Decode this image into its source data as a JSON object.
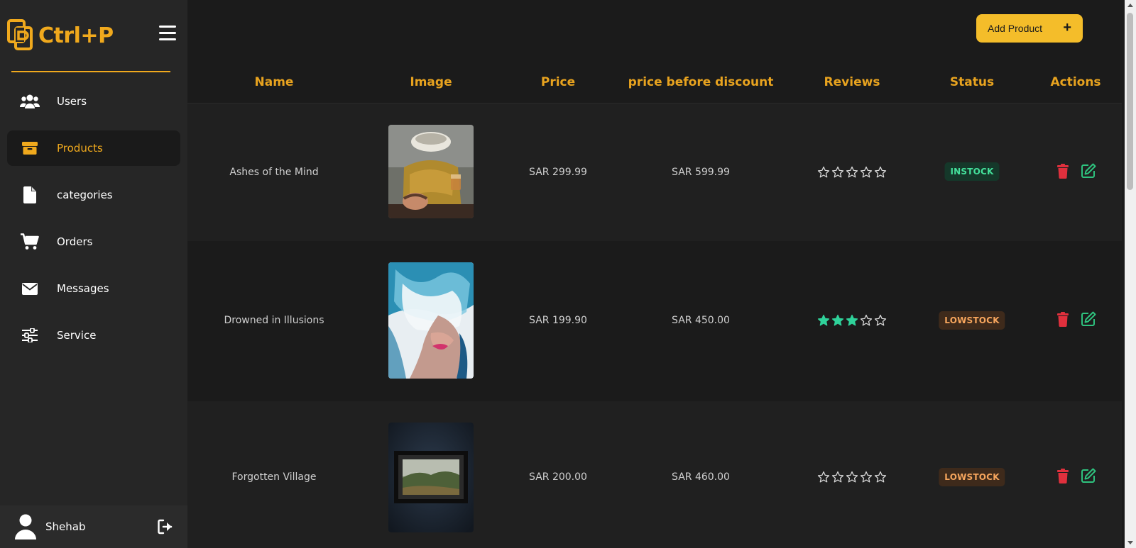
{
  "brand": {
    "name": "Ctrl+P",
    "logo_icon": "ctrlp-logo-icon",
    "accent": "#f0a91d"
  },
  "sidebar": {
    "items": [
      {
        "label": "Users",
        "icon": "users-icon",
        "active": false
      },
      {
        "label": "Products",
        "icon": "box-icon",
        "active": true
      },
      {
        "label": "categories",
        "icon": "file-icon",
        "active": false
      },
      {
        "label": "Orders",
        "icon": "cart-icon",
        "active": false
      },
      {
        "label": "Messages",
        "icon": "envelope-icon",
        "active": false
      },
      {
        "label": "Service",
        "icon": "sliders-icon",
        "active": false
      }
    ],
    "footer": {
      "user_name": "Shehab",
      "avatar_icon": "user-icon",
      "logout_icon": "logout-icon"
    }
  },
  "toolbar": {
    "add_label": "Add Product",
    "add_icon": "plus-icon",
    "add_plus": "+"
  },
  "table": {
    "headers": [
      "Name",
      "Image",
      "Price",
      "price before discount",
      "Reviews",
      "Status",
      "Actions"
    ],
    "rows": [
      {
        "name": "Ashes of the Mind",
        "image": "painting-ashes-of-the-mind",
        "price": "SAR 299.99",
        "price_before": "SAR 599.99",
        "rating": 0,
        "status": "INSTOCK"
      },
      {
        "name": "Drowned in Illusions",
        "image": "painting-drowned-in-illusions",
        "price": "SAR 199.90",
        "price_before": "SAR 450.00",
        "rating": 3,
        "status": "LOWSTOCK"
      },
      {
        "name": "Forgotten Village",
        "image": "painting-forgotten-village",
        "price": "SAR 200.00",
        "price_before": "SAR 460.00",
        "rating": 0,
        "status": "LOWSTOCK"
      }
    ],
    "rating_max": 5,
    "colors": {
      "header": "#e8a31f",
      "star_filled": "#2fd29a",
      "delete": "#e0303d",
      "edit": "#2ec27e"
    }
  }
}
